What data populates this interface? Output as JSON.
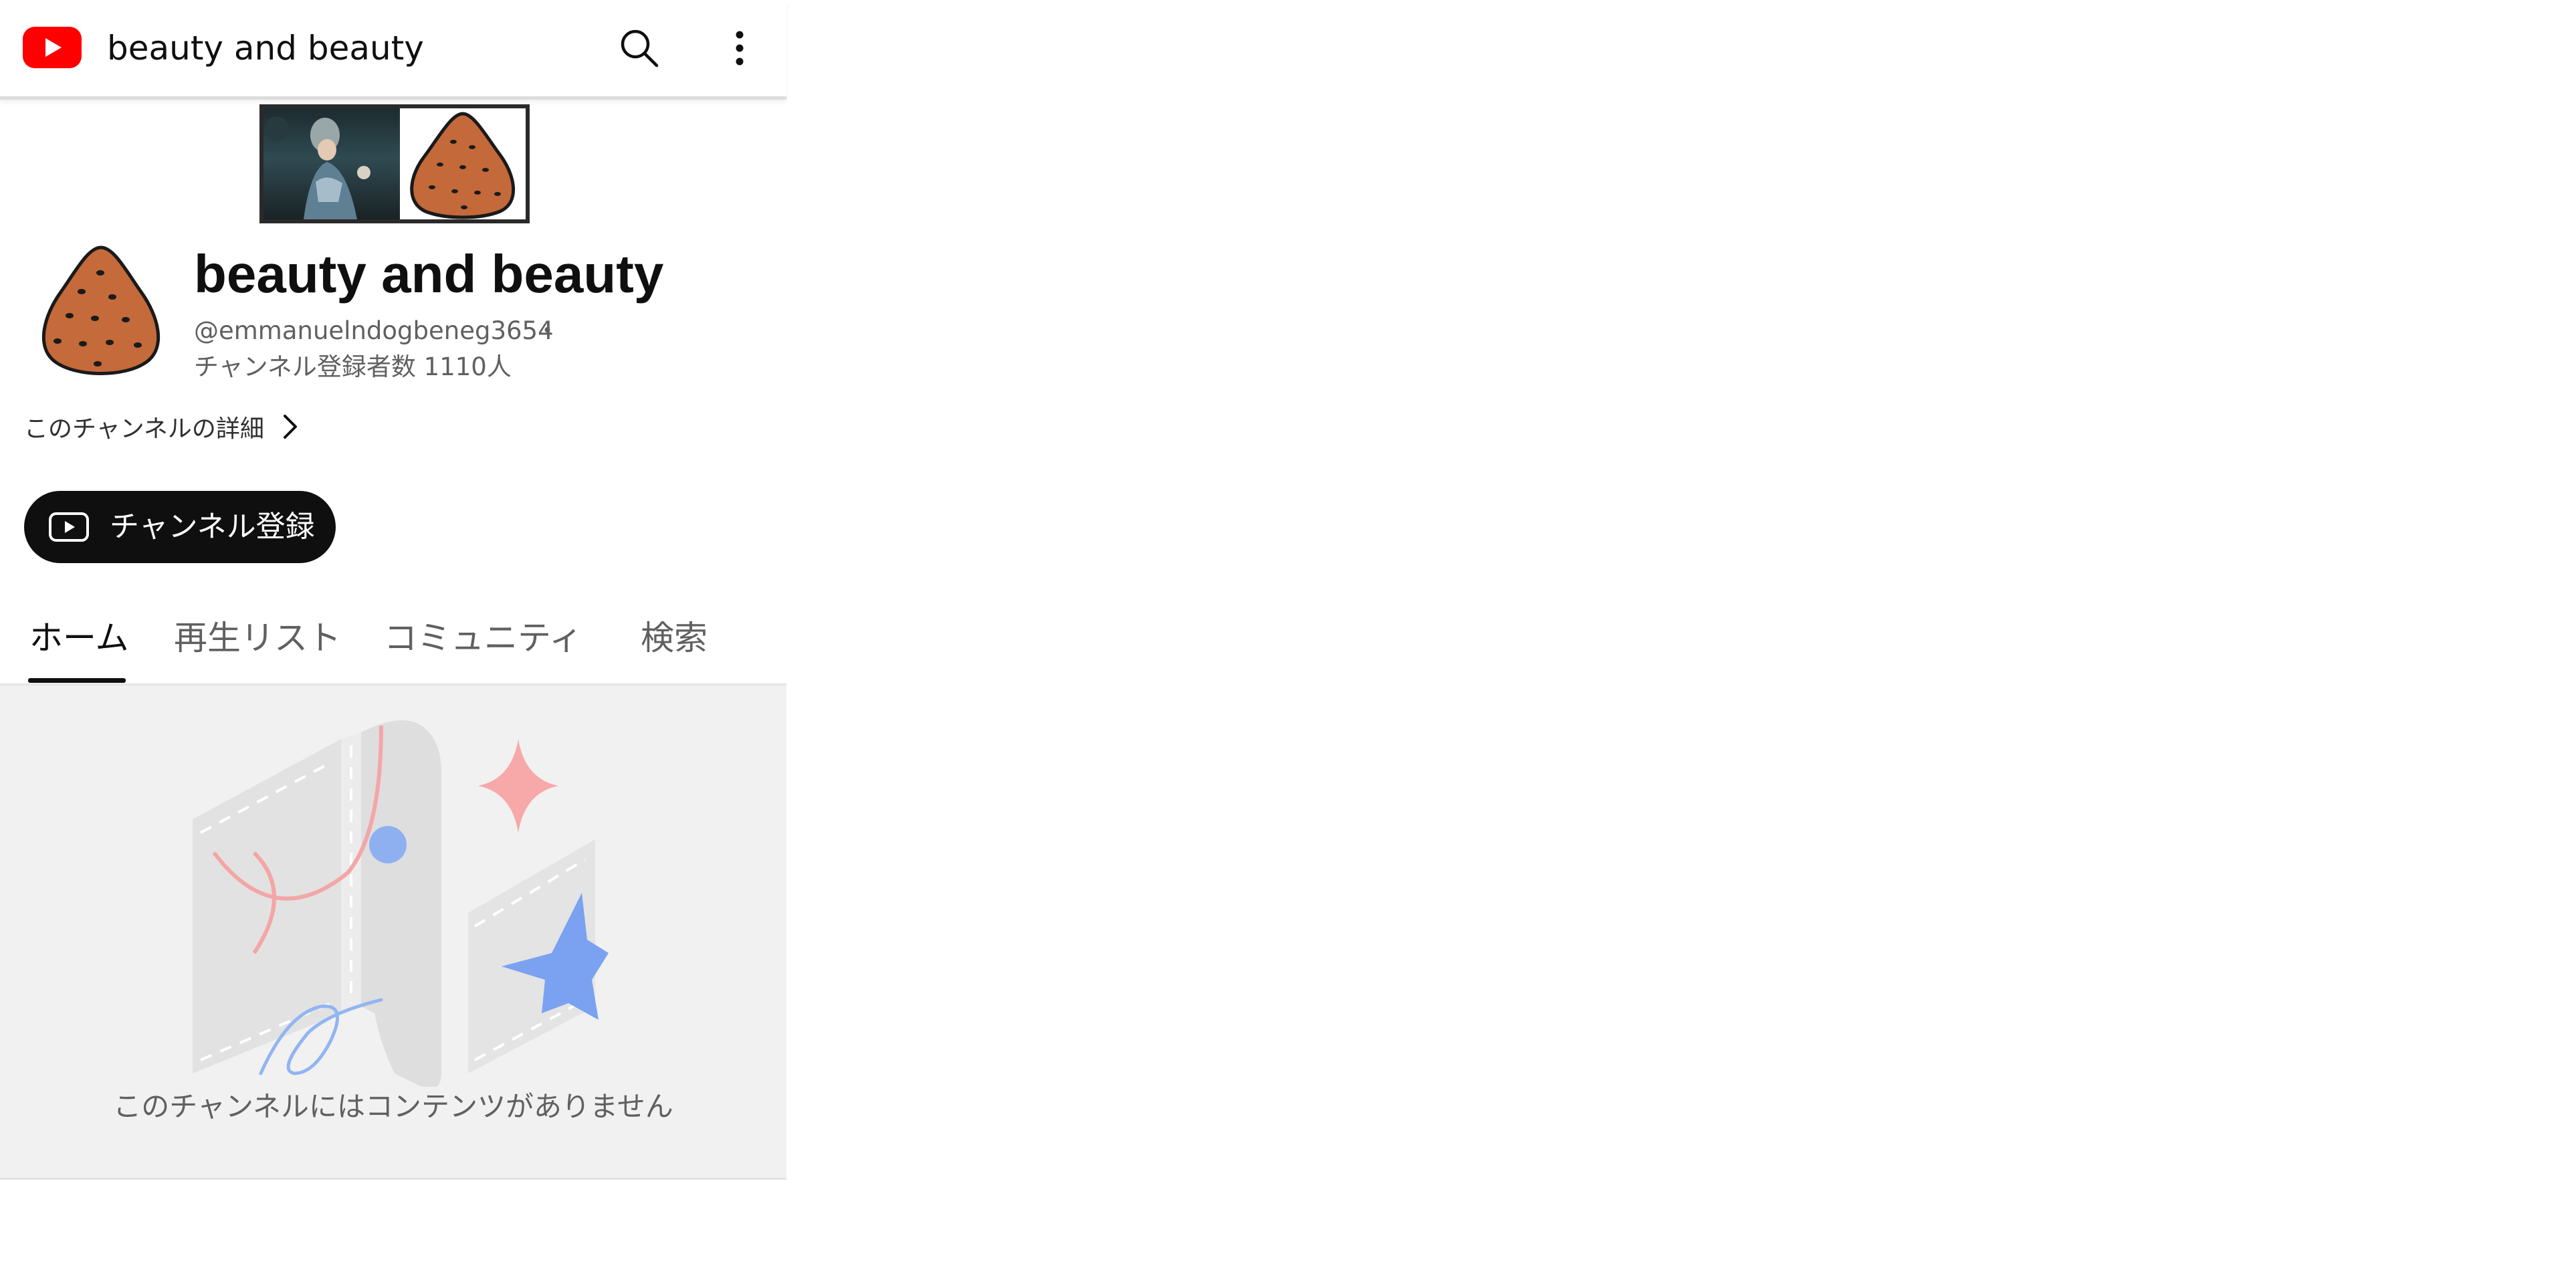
{
  "topbar": {
    "logo_icon": "youtube-logo-icon",
    "title": "beauty and beauty",
    "search_icon": "search-icon",
    "more_icon": "more-vertical-icon"
  },
  "channel": {
    "name": "beauty and beauty",
    "handle": "@emmanuelndogbeneg3654",
    "separator": "・",
    "subscribers": "チャンネル登録者数 1110人",
    "about_link": "このチャンネルの詳細",
    "subscribe_label": "チャンネル登録"
  },
  "tabs": [
    {
      "label": "ホーム",
      "active": true
    },
    {
      "label": "再生リスト",
      "active": false
    },
    {
      "label": "コミュニティ",
      "active": false
    },
    {
      "label": "検索",
      "active": false
    }
  ],
  "empty_state": {
    "message": "このチャンネルにはコンテンツがありません"
  },
  "colors": {
    "brand_red": "#ff0000",
    "subscribe_bg": "#0f0f0f",
    "secondary_text": "#606060",
    "empty_bg": "#f1f1f1"
  }
}
